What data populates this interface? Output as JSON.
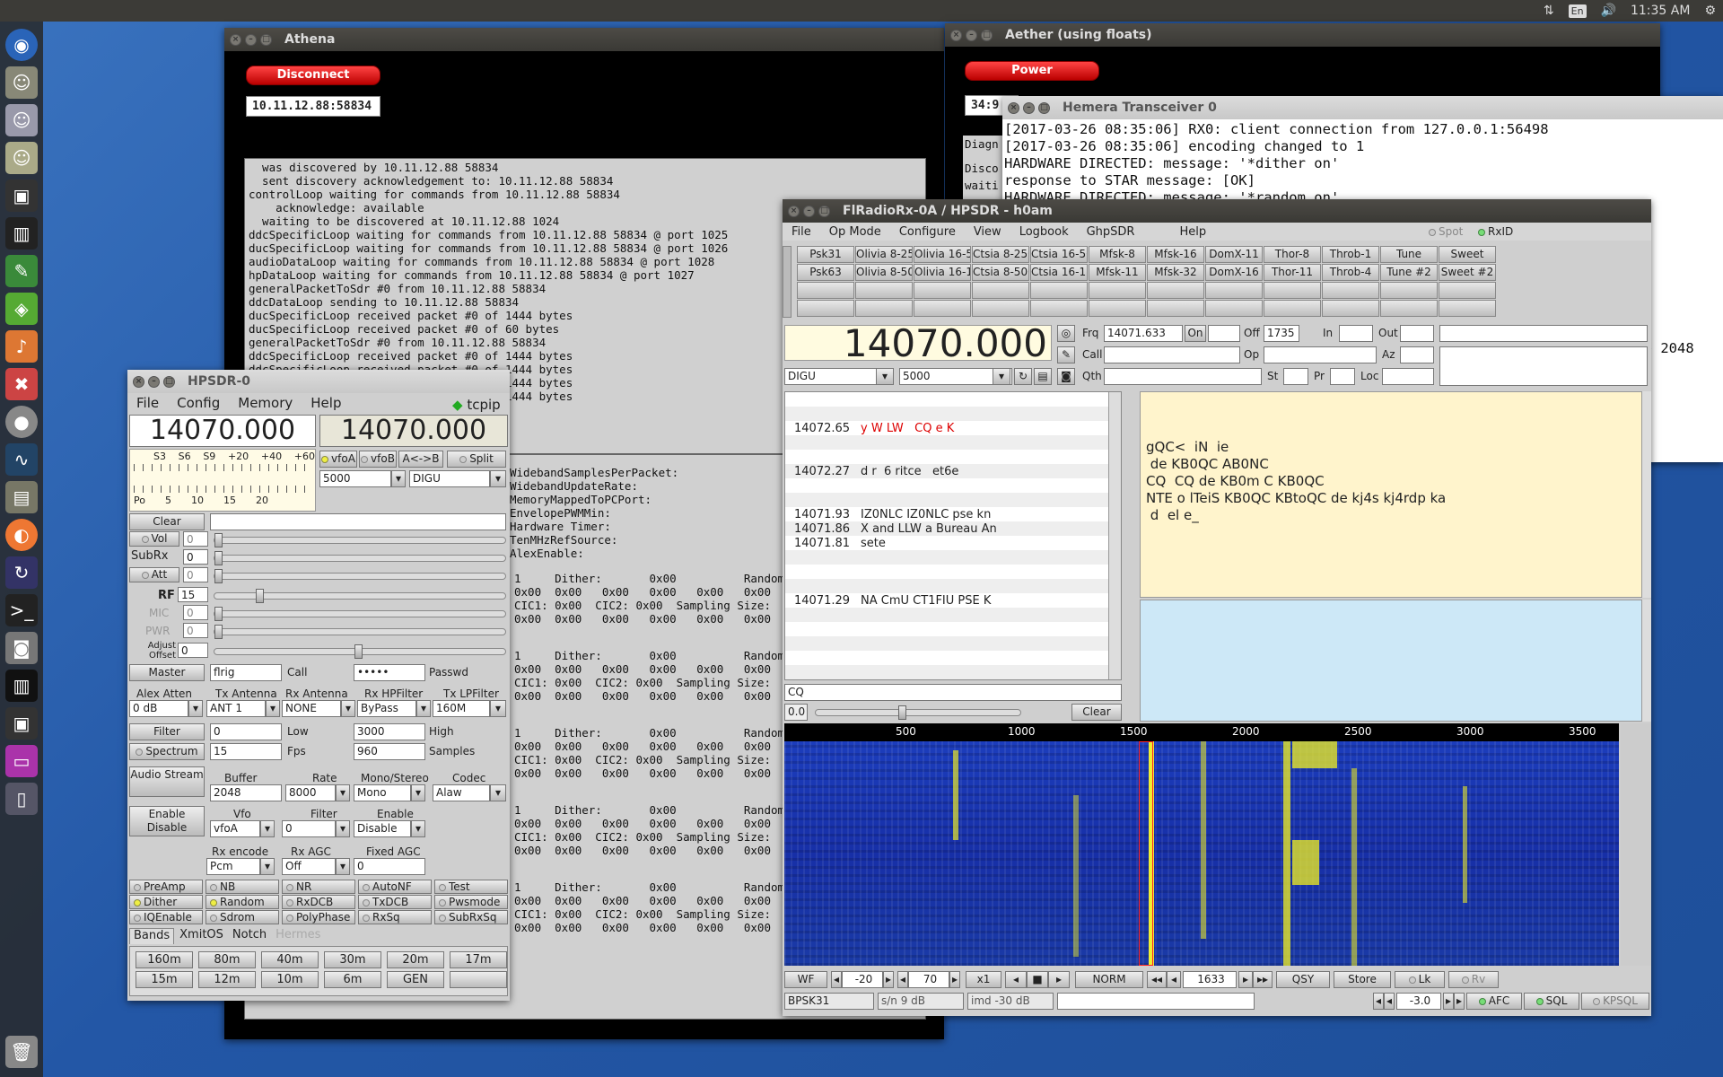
{
  "toppanel": {
    "lang": "En",
    "time": "11:35 AM"
  },
  "athena": {
    "title": "Athena",
    "disconnect": "Disconnect",
    "address": "10.11.12.88:58834",
    "log": [
      "  was discovered by 10.11.12.88 58834",
      "  sent discovery acknowledgement to: 10.11.12.88 58834",
      "controlLoop waiting for commands from 10.11.12.88 58834",
      "    acknowledge: available",
      "  waiting to be discovered at 10.11.12.88 1024",
      "ddcSpecificLoop waiting for commands from 10.11.12.88 58834 @ port 1025",
      "ducSpecificLoop waiting for commands from 10.11.12.88 58834 @ port 1026",
      "audioDataLoop waiting for commands from 10.11.12.88 58834 @ port 1028",
      "hpDataLoop waiting for commands from 10.11.12.88 58834 @ port 1027",
      "generalPacketToSdr #0 from 10.11.12.88 58834",
      "ddcDataLoop sending to 10.11.12.88 58834",
      "ducSpecificLoop received packet #0 of 1444 bytes",
      "ducSpecificLoop received packet #0 of 60 bytes",
      "generalPacketToSdr #0 from 10.11.12.88 58834",
      "ddcSpecificLoop received packet #0 of 1444 bytes",
      "ddcSpecificLoop received packet #0 of 1444 bytes",
      "ducSpecificLoop received packet #0 of 1444 bytes",
      "ducSpecificLoop received packet #0 of 1444 bytes"
    ],
    "params": [
      "WidebandSamplesPerPacket:",
      "WidebandUpdateRate:",
      "MemoryMappedToPCPort:",
      "EnvelopePWMMin:",
      "Hardware Timer:",
      "TenMHzRefSource:",
      "AlexEnable:"
    ],
    "ddc": [
      "1     Dither:       0x00          Random",
      "0x00  0x00   0x00   0x00   0x00   0x00",
      "CIC1: 0x00  CIC2: 0x00  Sampling Size:",
      "0x00  0x00   0x00   0x00   0x00   0x00"
    ]
  },
  "aether": {
    "title": "Aether (using floats)",
    "power": "Power",
    "addr": "34:9",
    "diag": "Diagn",
    "disco": "Disco",
    "waiti": "waiti"
  },
  "hemera": {
    "title": "Hemera Transceiver 0",
    "log": [
      "[2017-03-26 08:35:06] RX0: client connection from 127.0.0.1:56498",
      "[2017-03-26 08:35:06] encoding changed to 1",
      "HARDWARE DIRECTED: message: '*dither on'",
      "response to STAR message: [OK]",
      "HARDWARE DIRECTED: message: '*random on'"
    ],
    "side": "ize 2048"
  },
  "fl": {
    "title": "FlRadioRx-0A / HPSDR - h0am",
    "menu": [
      "File",
      "Op Mode",
      "Configure",
      "View",
      "Logbook",
      "GhpSDR",
      "Help"
    ],
    "spot": "Spot",
    "rxid": "RxID",
    "modes1": [
      "Psk31",
      "Olivia 8-250",
      "Olivia 16-500",
      "Ctsia 8-250",
      "Ctsia 16-500",
      "Mfsk-8",
      "Mfsk-16",
      "DomX-11",
      "Thor-8",
      "Throb-1",
      "Tune",
      "Sweet"
    ],
    "modes2": [
      "Psk63",
      "Olivia 8-500",
      "Olivia 16-1K",
      "Ctsia 8-500",
      "Ctsia 16-1K",
      "Mfsk-11",
      "Mfsk-32",
      "DomX-16",
      "Thor-11",
      "Throb-4",
      "Tune #2",
      "Sweet #2"
    ],
    "freq": "14070.000",
    "mode": "DIGU",
    "bw": "5000",
    "frq_label": "Frq",
    "frq": "14071.633",
    "on": "On",
    "off_label": "Off",
    "off": "1735",
    "in": "In",
    "out": "Out",
    "call": "Call",
    "op": "Op",
    "az": "Az",
    "qth": "Qth",
    "st": "St",
    "pr": "Pr",
    "loc": "Loc",
    "browser": [
      {
        "f": "14072.65",
        "t": "y W LW   CQ e K",
        "red": true
      },
      {
        "f": "14072.27",
        "t": "d r  6 ritce   et6e",
        "red": false
      },
      {
        "f": "14071.93",
        "t": "IZ0NLC IZ0NLC pse kn",
        "red": false
      },
      {
        "f": "14071.86",
        "t": "X and LLW a Bureau An",
        "red": false
      },
      {
        "f": "14071.81",
        "t": "sete",
        "red": false
      },
      {
        "f": "14071.29",
        "t": "NA CmU CT1FIU PSE K",
        "red": false
      }
    ],
    "search": "CQ",
    "sq": "0.0",
    "clear": "Clear",
    "rx": [
      "gQC<  iN  ie",
      " de KB0QC AB0NC",
      "CQ  CQ de KB0m C KB0QC",
      "NTE o lTeiS KB0QC KBtoQC de kj4s kj4rdp ka",
      " d  el e_"
    ],
    "scale": [
      "500",
      "1000",
      "1500",
      "2000",
      "2500",
      "3000",
      "3500"
    ],
    "wf": "WF",
    "ref": "-20",
    "rng": "70",
    "x1": "x1",
    "norm": "NORM",
    "cf": "1633",
    "qsy": "QSY",
    "store": "Store",
    "lk": "Lk",
    "rv": "Rv",
    "modem": "BPSK31",
    "sn": "s/n  9 dB",
    "imd": "imd -30 dB",
    "afcval": "-3.0",
    "afc": "AFC",
    "sql": "SQL",
    "kpsql": "KPSQL"
  },
  "hp": {
    "title": "HPSDR-0",
    "menu": [
      "File",
      "Config",
      "Memory",
      "Help"
    ],
    "tcpip": "tcpip",
    "freqA": "14070.000",
    "freqB": "14070.000",
    "smeter": [
      "S3",
      "S6",
      "S9",
      "+20",
      "+40",
      "+60"
    ],
    "pmeter": [
      "Po",
      "5",
      "10",
      "15",
      "20"
    ],
    "vfoA": "vfoA",
    "vfoB": "vfoB",
    "swap": "A<->B",
    "split": "Split",
    "bw": "5000",
    "mode": "DIGU",
    "clear": "Clear",
    "vol": "Vol",
    "vol_v": "0",
    "subrx": "SubRx",
    "subrx_v": "0",
    "att": "Att",
    "att_v": "0",
    "rf": "RF",
    "rf_v": "15",
    "mic": "MIC",
    "mic_v": "0",
    "pwr": "PWR",
    "pwr_v": "0",
    "adj": "Adjust Offset",
    "adj_v": "0",
    "master": "Master",
    "master_v": "flrig",
    "call": "Call",
    "passwd_v": "•••••",
    "passwd": "Passwd",
    "h_alex": "Alex Atten",
    "h_txa": "Tx Antenna",
    "h_rxa": "Rx Antenna",
    "h_rxhp": "Rx HPFilter",
    "h_txlp": "Tx LPFilter",
    "alex": "0 dB",
    "txa": "ANT 1",
    "rxa": "NONE",
    "rxhp": "ByPass",
    "txlp": "160M",
    "filter": "Filter",
    "filter_lo": "0",
    "low": "Low",
    "filter_hi": "3000",
    "high": "High",
    "spectrum": "Spectrum",
    "fps_v": "15",
    "fps": "Fps",
    "samples_v": "960",
    "samples": "Samples",
    "audio": "Audio Stream",
    "buffer": "Buffer",
    "buffer_v": "2048",
    "rate": "Rate",
    "rate_v": "8000",
    "ms": "Mono/Stereo",
    "ms_v": "Mono",
    "codec": "Codec",
    "codec_v": "Alaw",
    "ed": "Enable Disable",
    "vfo": "Vfo",
    "vfo_v": "vfoA",
    "filt": "Filter",
    "filt_v": "0",
    "enable": "Enable",
    "enable_v": "Disable",
    "rxenc": "Rx encode",
    "rxenc_v": "Pcm",
    "rxagc": "Rx AGC",
    "rxagc_v": "Off",
    "fagc": "Fixed AGC",
    "fagc_v": "0",
    "checks": [
      "PreAmp",
      "NB",
      "NR",
      "AutoNF",
      "Test",
      "Dither",
      "Random",
      "RxDCB",
      "TxDCB",
      "Pwsmode",
      "IQEnable",
      "Sdrom",
      "PolyPhase",
      "RxSq",
      "SubRxSq"
    ],
    "tabs": [
      "Bands",
      "XmitOS",
      "Notch",
      "Hermes"
    ],
    "bands": [
      "160m",
      "80m",
      "40m",
      "30m",
      "20m",
      "17m",
      "15m",
      "12m",
      "10m",
      "6m",
      "GEN",
      ""
    ]
  }
}
